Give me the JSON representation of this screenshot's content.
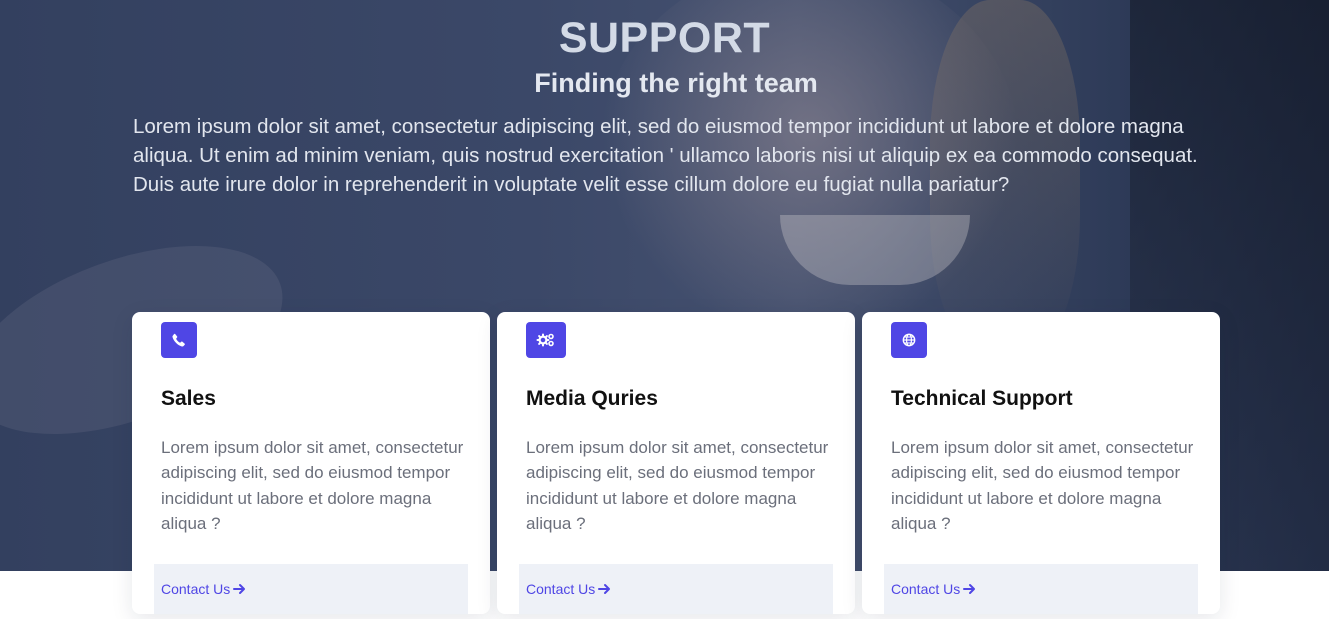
{
  "hero": {
    "title": "SUPPORT",
    "subtitle": "Finding the right team",
    "text": "Lorem ipsum dolor sit amet, consectetur adipiscing elit, sed do eiusmod tempor incididunt ut labore et dolore magna aliqua. Ut enim ad minim veniam, quis nostrud exercitation ' ullamco laboris nisi ut aliquip ex ea commodo consequat. Duis aute irure dolor in reprehenderit in voluptate velit esse cillum dolore eu fugiat nulla pariatur?"
  },
  "cards": [
    {
      "icon": "phone-icon",
      "title": "Sales",
      "text": "Lorem ipsum dolor sit amet, consectetur adipiscing elit, sed do eiusmod tempor incididunt ut labore et dolore magna aliqua ?",
      "link": "Contact Us"
    },
    {
      "icon": "gears-icon",
      "title": "Media Quries",
      "text": "Lorem ipsum dolor sit amet, consectetur adipiscing elit, sed do eiusmod tempor incididunt ut labore et dolore magna aliqua ?",
      "link": "Contact Us"
    },
    {
      "icon": "globe-icon",
      "title": "Technical Support",
      "text": "Lorem ipsum dolor sit amet, consectetur adipiscing elit, sed do eiusmod tempor incididunt ut labore et dolore magna aliqua ?",
      "link": "Contact Us"
    }
  ],
  "colors": {
    "accent": "#4f46e5",
    "hero_overlay": "#3b4868",
    "footer_bg": "#eef1f7"
  }
}
